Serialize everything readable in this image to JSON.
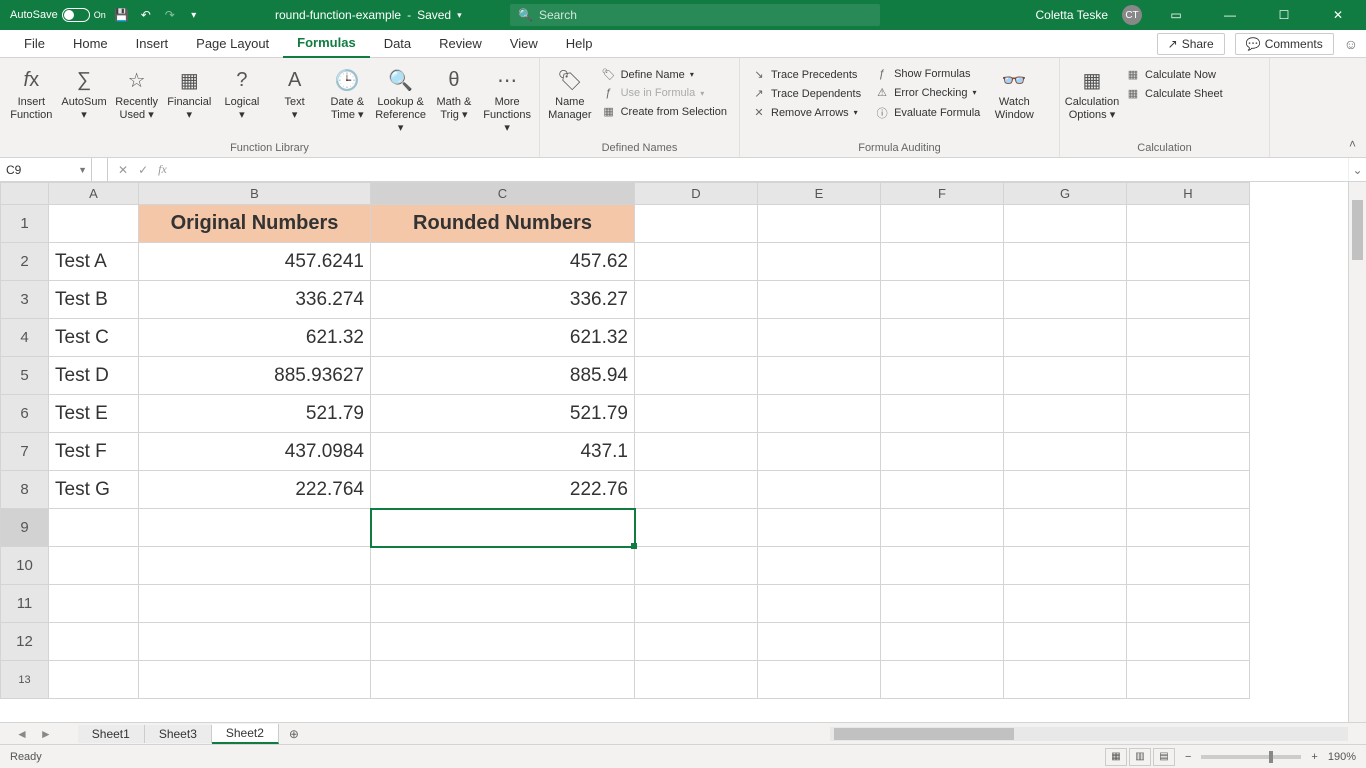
{
  "titlebar": {
    "autosave_label": "AutoSave",
    "autosave_state": "On",
    "filename": "round-function-example",
    "saved_state": "Saved",
    "search_placeholder": "Search",
    "username": "Coletta Teske",
    "user_initials": "CT"
  },
  "tabs": {
    "items": [
      "File",
      "Home",
      "Insert",
      "Page Layout",
      "Formulas",
      "Data",
      "Review",
      "View",
      "Help"
    ],
    "active": "Formulas",
    "share_label": "Share",
    "comments_label": "Comments"
  },
  "ribbon": {
    "groups": {
      "function_library": {
        "label": "Function Library",
        "insert_function": "Insert\nFunction",
        "autosum": "AutoSum",
        "recently_used": "Recently\nUsed",
        "financial": "Financial",
        "logical": "Logical",
        "text": "Text",
        "date_time": "Date &\nTime",
        "lookup_reference": "Lookup &\nReference",
        "math_trig": "Math &\nTrig",
        "more_functions": "More\nFunctions"
      },
      "defined_names": {
        "label": "Defined Names",
        "name_manager": "Name\nManager",
        "define_name": "Define Name",
        "use_in_formula": "Use in Formula",
        "create_from_selection": "Create from Selection"
      },
      "formula_auditing": {
        "label": "Formula Auditing",
        "trace_precedents": "Trace Precedents",
        "trace_dependents": "Trace Dependents",
        "remove_arrows": "Remove Arrows",
        "show_formulas": "Show Formulas",
        "error_checking": "Error Checking",
        "evaluate_formula": "Evaluate Formula",
        "watch_window": "Watch\nWindow"
      },
      "calculation": {
        "label": "Calculation",
        "calculation_options": "Calculation\nOptions",
        "calculate_now": "Calculate Now",
        "calculate_sheet": "Calculate Sheet"
      }
    }
  },
  "namebox": {
    "value": "C9"
  },
  "formula": {
    "value": ""
  },
  "columns": [
    "A",
    "B",
    "C",
    "D",
    "E",
    "F",
    "G",
    "H"
  ],
  "rows": [
    "1",
    "2",
    "3",
    "4",
    "5",
    "6",
    "7",
    "8",
    "9",
    "10",
    "11",
    "12",
    "13"
  ],
  "headers": {
    "b": "Original Numbers",
    "c": "Rounded Numbers"
  },
  "data_rows": [
    {
      "label": "Test A",
      "orig": "457.6241",
      "round": "457.62"
    },
    {
      "label": "Test B",
      "orig": "336.274",
      "round": "336.27"
    },
    {
      "label": "Test C",
      "orig": "621.32",
      "round": "621.32"
    },
    {
      "label": "Test D",
      "orig": "885.93627",
      "round": "885.94"
    },
    {
      "label": "Test E",
      "orig": "521.79",
      "round": "521.79"
    },
    {
      "label": "Test F",
      "orig": "437.0984",
      "round": "437.1"
    },
    {
      "label": "Test G",
      "orig": "222.764",
      "round": "222.76"
    }
  ],
  "sheet_tabs": {
    "items": [
      "Sheet1",
      "Sheet3",
      "Sheet2"
    ],
    "active": "Sheet2"
  },
  "statusbar": {
    "ready": "Ready",
    "zoom": "190%"
  }
}
